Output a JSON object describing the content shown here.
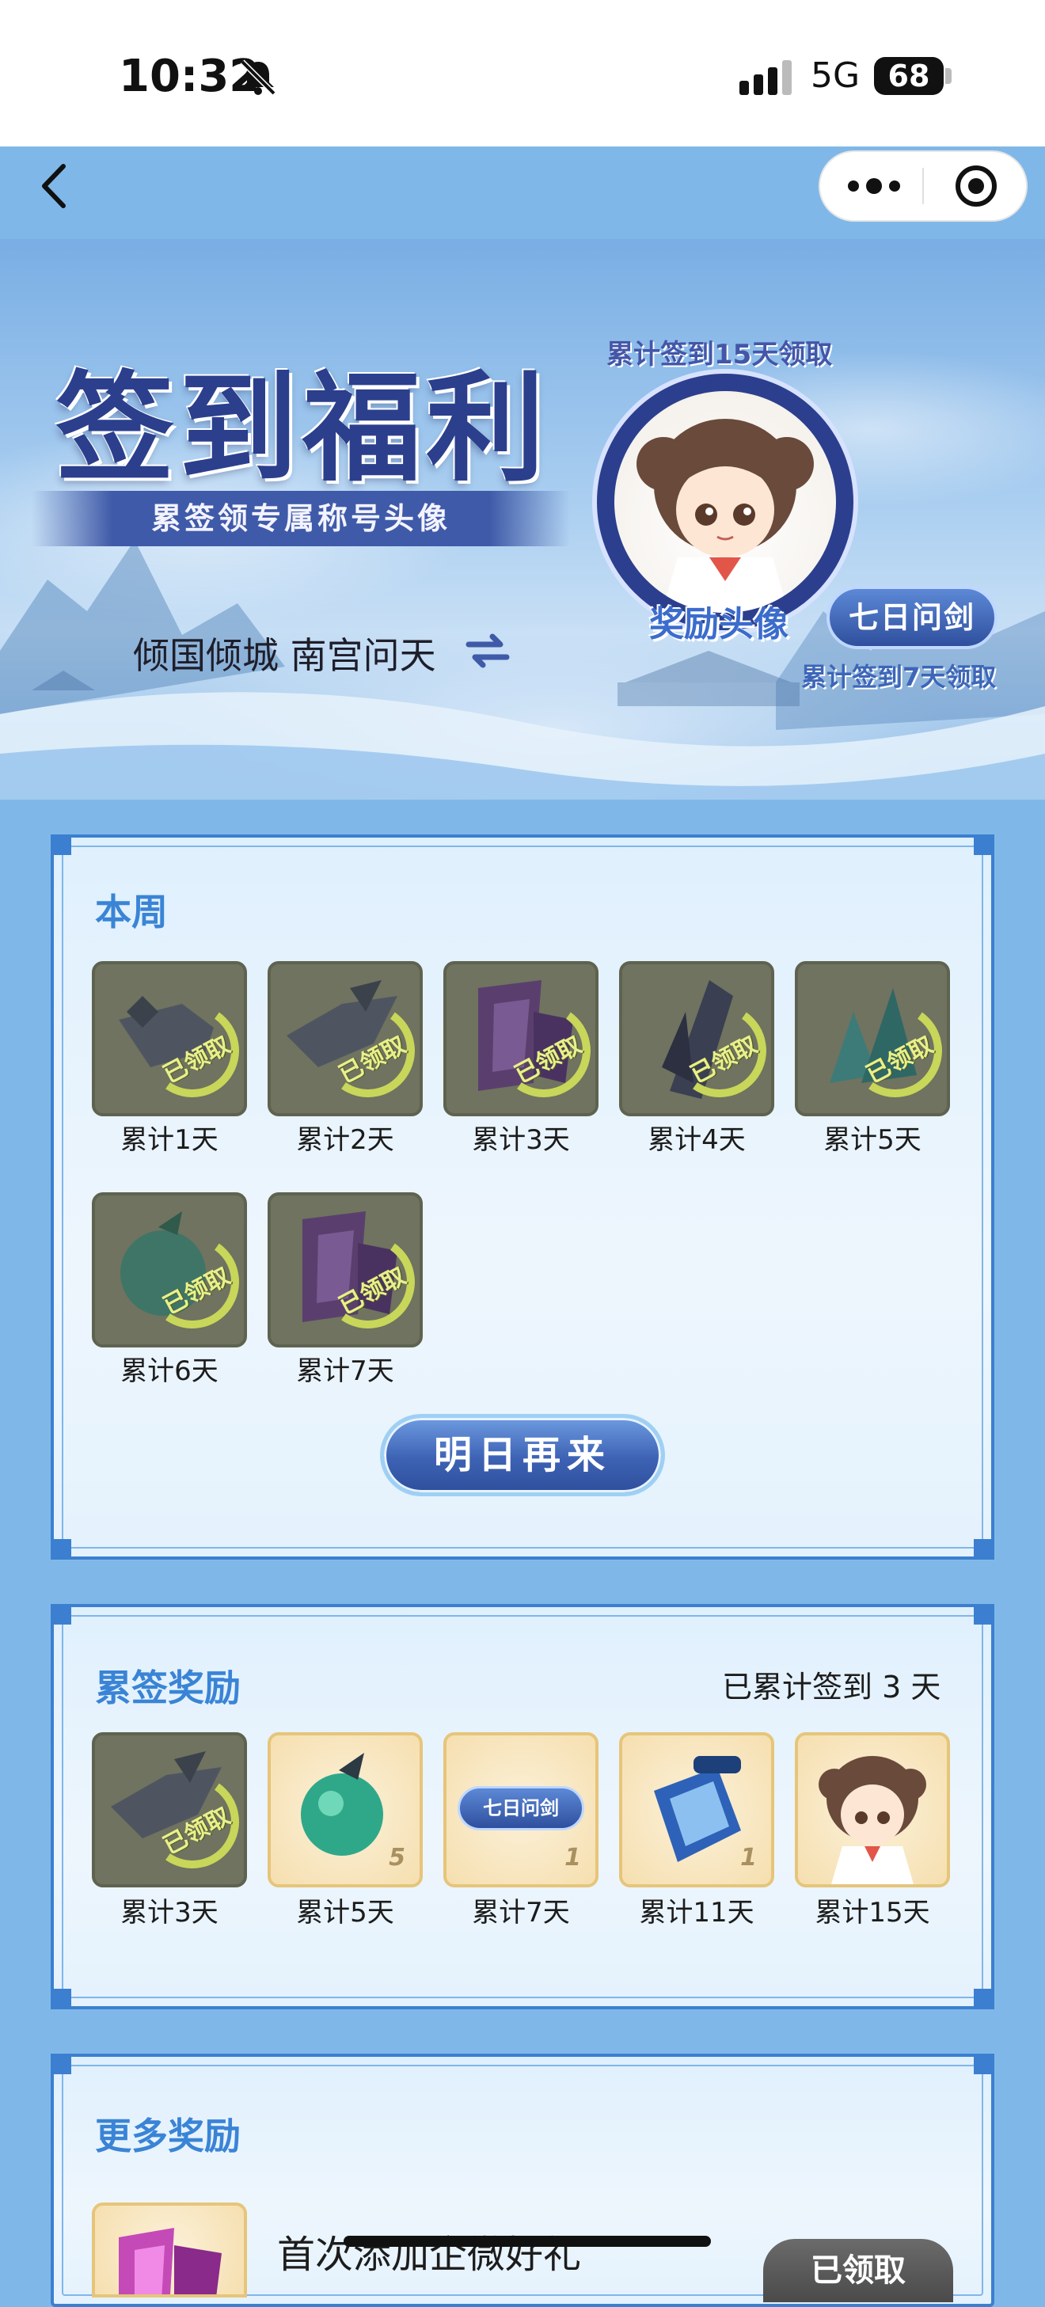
{
  "status_bar": {
    "time": "10:32",
    "network": "5G",
    "battery": "68"
  },
  "banner": {
    "title": "签到福利",
    "subtitle": "累签领专属称号头像",
    "server": "倾国倾城 南宫问天",
    "avatar_tip": "累计签到15天领取",
    "avatar_label": "奖励头像",
    "title_badge": "七日问剑",
    "title_tip": "累计签到7天领取"
  },
  "week": {
    "title": "本周",
    "stamp": "已领取",
    "items": [
      {
        "label": "累计1天",
        "icon": "wrench-tool-icon",
        "claimed": true
      },
      {
        "label": "累计2天",
        "icon": "gear-parts-icon",
        "claimed": true
      },
      {
        "label": "累计3天",
        "icon": "purple-gem-icon",
        "claimed": true
      },
      {
        "label": "累计4天",
        "icon": "dark-crystal-icon",
        "claimed": true
      },
      {
        "label": "累计5天",
        "icon": "teal-crystal-icon",
        "claimed": true
      },
      {
        "label": "累计6天",
        "icon": "green-fruit-icon",
        "claimed": true
      },
      {
        "label": "累计7天",
        "icon": "purple-gem-icon",
        "claimed": true
      }
    ],
    "button": "明日再来"
  },
  "cumulative": {
    "title": "累签奖励",
    "status": "已累计签到 3 天",
    "items": [
      {
        "label": "累计3天",
        "icon": "gear-parts-icon",
        "claimed": true,
        "count": ""
      },
      {
        "label": "累计5天",
        "icon": "green-fruit-icon",
        "claimed": false,
        "count": "5"
      },
      {
        "label": "累计7天",
        "icon": "title-card-icon",
        "claimed": false,
        "count": "1",
        "card_text": "七日问剑"
      },
      {
        "label": "累计11天",
        "icon": "blue-scroll-icon",
        "claimed": false,
        "count": "1"
      },
      {
        "label": "累计15天",
        "icon": "girl-avatar-icon",
        "claimed": false,
        "count": ""
      }
    ]
  },
  "more": {
    "title": "更多奖励",
    "item_name": "首次添加企微好礼",
    "item_button": "已领取"
  },
  "colors": {
    "accent": "#3a84d6",
    "panel_border": "#3c7fd0",
    "claimed_stamp": "#c8d65a",
    "button_blue": "#3d62b4"
  }
}
